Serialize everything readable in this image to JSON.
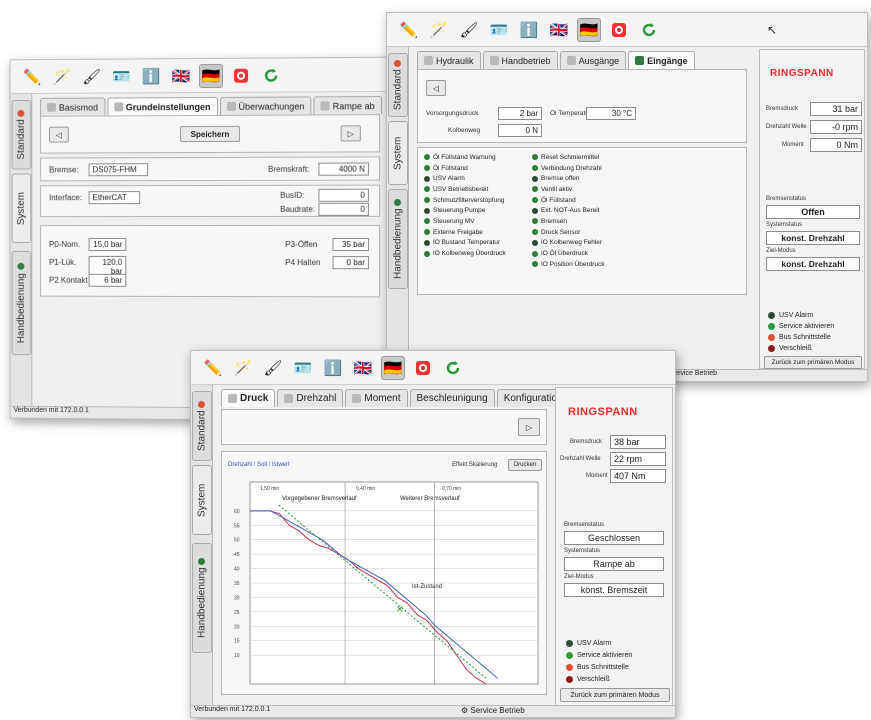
{
  "colors": {
    "brand": "#e0312c",
    "ok": "#2f7d3a",
    "warn": "#e05030",
    "err": "#8b1d1d",
    "grid": "#c8c8c8"
  },
  "toolbar_icons": [
    "pencil-icon",
    "wand-icon",
    "brush-icon",
    "card-icon",
    "info-icon",
    "uk-flag-icon",
    "german-flag-icon",
    "record-icon",
    "refresh-icon"
  ],
  "sidebar": {
    "standard": "Standard",
    "system": "System",
    "manual": "Handbedienung"
  },
  "logo": "RINGSPANN",
  "left": {
    "tabs": [
      "Basismod",
      "Grundeinstellungen",
      "Überwachungen",
      "Rampe ab"
    ],
    "save": "Speichern",
    "brake_label": "Bremse:",
    "brake_value": "DS075-FHM",
    "force_label": "Bremskraft:",
    "force_value": "4000 N",
    "interface_label": "Interface:",
    "interface_value": "EtherCAT",
    "busid_label": "BusID:",
    "busid_value": "0",
    "baud_label": "Baudrate:",
    "baud_value": "0",
    "p0_label": "P0-Nom.",
    "p0_value": "15,0 bar",
    "p1_label": "P1-Lük.",
    "p1_value": "120,0 bar",
    "p2_label": "P2 Kontakt",
    "p2_value": "6 bar",
    "p3_label": "P3-Öffen",
    "p3_value": "35 bar",
    "p4_label": "P4 Halten",
    "p4_value": "0 bar",
    "status": "Verbunden mit 172.0.0.1"
  },
  "right": {
    "tabs": [
      "Hydraulik",
      "Handbetrieb",
      "Ausgänge",
      "Eingänge"
    ],
    "pre_label": "Vorsorgungsdruck",
    "pre_value": "2 bar",
    "oil_label": "Öl Temperatur",
    "oil_value": "30 °C",
    "ks_label": "Kolbenweg",
    "ks_value": "0 N",
    "inputs_left": [
      "Öl Füllstand Warnung",
      "Öl Füllstand",
      "USV Alarm",
      "USV Betriebsbereit",
      "Schmutzfilterverstopfung",
      "Steuerung Pumpe",
      "Steuerung MV",
      "Externe Freigabe",
      "IO Bustand Temperatur",
      "IO Kolbenweg Überdruck"
    ],
    "inputs_right": [
      "Reset Schmiermittel",
      "Verbindung Drehzahl",
      "Bremse offen",
      "Ventil aktiv",
      "Öl Füllstand",
      "Ext. NOT-Aus Bereit",
      "Bremsen",
      "Druck Sensor",
      "IO Kolbenweg Fehler",
      "IO Öl Überdruck",
      "IO Position Überdruck"
    ],
    "pressure_label": "Bremsdruck",
    "pressure_value": "31 bar",
    "speed_label": "Drehzahl Welle",
    "speed_value": "-0 rpm",
    "torque_label": "Moment",
    "torque_value": "0 Nm",
    "brake_state_label": "Bremsenstatus",
    "brake_state": "Offen",
    "system_label": "Systemstatus",
    "system_state": "konst. Drehzahl",
    "target_label": "Ziel-Modus",
    "target_state": "konst. Drehzahl",
    "indicators": [
      "USV Alarm",
      "Service aktivieren",
      "Bus Schnittstelle",
      "Verschleiß"
    ],
    "back_button": "Zurück zum primären Modus",
    "service": "Service Betrieb"
  },
  "front": {
    "tabs": [
      "Druck",
      "Drehzahl",
      "Moment",
      "Beschleunigung",
      "Konfiguration"
    ],
    "legend": "Drehzahl / Soll / Istwert",
    "zoom_label": "Effekt Skalierung",
    "zoom_button": "Drucken",
    "phase1": "Vorgegebener Bremsverlauf",
    "phase2": "Weiterer Bremsverlauf",
    "marker_label": "Ist-Zustand",
    "time_labels": [
      "1,50 min",
      "0,40 min",
      "0,70 min"
    ],
    "y_ticks": [
      "60",
      "55",
      "50",
      "45",
      "40",
      "35",
      "30",
      "25",
      "20",
      "15",
      "10"
    ],
    "pressure_label": "Bremsdruck",
    "pressure_value": "38 bar",
    "speed_label": "Drehzahl Welle",
    "speed_value": "22 rpm",
    "torque_label": "Moment",
    "torque_value": "407 Nm",
    "brake_state_label": "Bremsenstatus",
    "brake_state": "Geschlossen",
    "system_label": "Systemstatus",
    "system_state": "Rampe ab",
    "target_label": "Ziel-Modus",
    "target_state": "konst. Bremszeit",
    "indicators": [
      "USV Alarm",
      "Service aktivieren",
      "Bus Schnittstelle",
      "Verschleiß"
    ],
    "back_button": "Zurück zum primären Modus",
    "service": "Service Betrieb",
    "status": "Verbunden mit 172.0.0.1"
  },
  "chart_data": {
    "type": "line",
    "title": "",
    "xlabel": "",
    "ylabel": "",
    "ylim": [
      0,
      70
    ],
    "series": [
      {
        "values": [
          60,
          60,
          60,
          59,
          55,
          53,
          50,
          48,
          47,
          45,
          43,
          40,
          38,
          36,
          34,
          30,
          28,
          24,
          22,
          18,
          15,
          10,
          5,
          2,
          0
        ]
      },
      {
        "values": [
          60,
          60,
          60,
          58,
          56,
          54,
          52,
          50,
          47,
          44,
          42,
          40,
          38,
          36,
          33,
          30,
          27,
          24,
          20,
          17,
          14,
          11,
          8,
          5,
          2
        ]
      },
      {
        "values": [
          62,
          58,
          54,
          50,
          46,
          42,
          38,
          34,
          30,
          26,
          22,
          18,
          14,
          10,
          6,
          2
        ]
      }
    ]
  }
}
